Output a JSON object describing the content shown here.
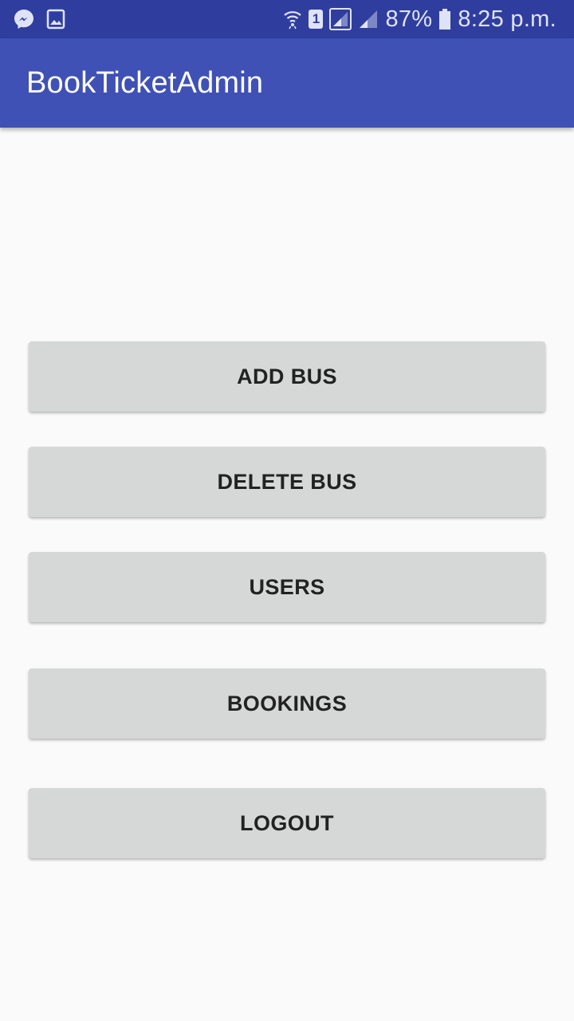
{
  "status_bar": {
    "battery_text": "87%",
    "time_text": "8:25 p.m.",
    "sim_slot": "1",
    "icons": [
      "messenger-icon",
      "gallery-icon",
      "wifi-icon",
      "sim-icon",
      "signal-icon",
      "signal-icon",
      "battery-icon"
    ]
  },
  "app_bar": {
    "title": "BookTicketAdmin",
    "color": "#3f51b5",
    "status_color": "#2f3e9e"
  },
  "menu": {
    "add_bus": "ADD BUS",
    "delete_bus": "DELETE BUS",
    "users": "USERS",
    "bookings": "BOOKINGS",
    "logout": "LOGOUT"
  }
}
